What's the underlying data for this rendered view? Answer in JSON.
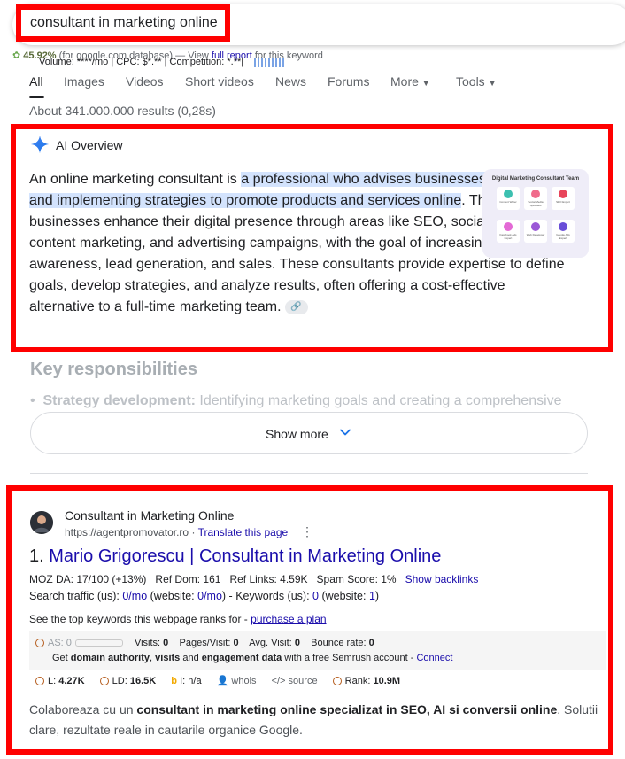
{
  "search": {
    "query": "consultant in marketing online"
  },
  "seo_bar": {
    "percent": "45.92%",
    "db_text": "(for google.com database) —",
    "view_text": "View",
    "full_report": "full report",
    "for_keyword": "for this keyword",
    "overlay": "Volume: ****/mo | CPC: $*.** | Competition: *.**|"
  },
  "tabs": [
    {
      "label": "All",
      "active": true
    },
    {
      "label": "Images"
    },
    {
      "label": "Videos"
    },
    {
      "label": "Short videos"
    },
    {
      "label": "News"
    },
    {
      "label": "Forums"
    },
    {
      "label": "More"
    },
    {
      "label": "Tools"
    }
  ],
  "results_count": "About 341.000.000 results (0,28s)",
  "ai_overview": {
    "label": "AI Overview",
    "text_1": "An online marketing consultant is ",
    "text_hl": "a professional who advises businesses on creating and implementing strategies to promote products and services online",
    "text_2": ". They help businesses enhance their digital presence through areas like SEO, social media, content marketing, and advertising campaigns, with the goal of increasing brand awareness, lead generation, and sales. These consultants provide expertise to define goals, develop strategies, and analyze results, often offering a cost-effective alternative to a full-time marketing team.",
    "thumb_title": "Digital Marketing Consultant Team",
    "thumb_cells": [
      "Content Writer",
      "Social Media Specialist",
      "SEO Expert",
      "Facebook Ads Expert",
      "Web Developer",
      "Google Ads Expert"
    ],
    "key_title": "Key responsibilities",
    "bullet_bold": "Strategy development:",
    "bullet_text": " Identifying marketing goals and creating a comprehensive",
    "show_more": "Show more"
  },
  "result": {
    "site_name": "Consultant in Marketing Online",
    "url": "https://agentpromovator.ro",
    "translate": "Translate this page",
    "number": "1.",
    "title": "Mario Grigorescu | Consultant in Marketing Online",
    "moz": {
      "da": "MOZ DA: 17/100 (+13%)",
      "ref_dom": "Ref Dom: 161",
      "ref_links": "Ref Links: 4.59K",
      "spam": "Spam Score: 1%",
      "backlinks": "Show backlinks"
    },
    "traffic": {
      "label_1": "Search traffic (us): ",
      "v1": "0/mo",
      "label_2": " (website: ",
      "v2": "0/mo",
      "label_3": ") - Keywords (us): ",
      "v3": "0",
      "label_4": " (website: ",
      "v4": "1",
      "label_5": ")"
    },
    "keywords_text": "See the top keywords this webpage ranks for - ",
    "purchase": "purchase a plan",
    "semrush": {
      "as": "AS: 0",
      "visits_label": "Visits:",
      "visits": "0",
      "pages_label": "Pages/Visit:",
      "pages": "0",
      "avg_label": "Avg. Visit:",
      "avg": "0",
      "bounce_label": "Bounce rate:",
      "bounce": "0",
      "promo_1": "Get ",
      "promo_b1": "domain authority",
      "promo_2": ", ",
      "promo_b2": "visits",
      "promo_3": " and ",
      "promo_b3": "engagement data",
      "promo_4": " with a free Semrush account - ",
      "connect": "Connect"
    },
    "metrics": {
      "l_label": "L:",
      "l": "4.27K",
      "ld_label": "LD:",
      "ld": "16.5K",
      "i_label": "I:",
      "i": "n/a",
      "whois": "whois",
      "source": "source",
      "rank_label": "Rank:",
      "rank": "10.9M"
    },
    "snippet_1": "Colaboreaza cu un ",
    "snippet_b": "consultant in marketing online specializat in SEO, AI si conversii online",
    "snippet_2": ". Solutii clare, rezultate reale in cautarile organice Google."
  },
  "colors": {
    "highlight_box": "#ff0000",
    "link": "#1a0dab",
    "ai_hl": "#d3e3fd"
  }
}
